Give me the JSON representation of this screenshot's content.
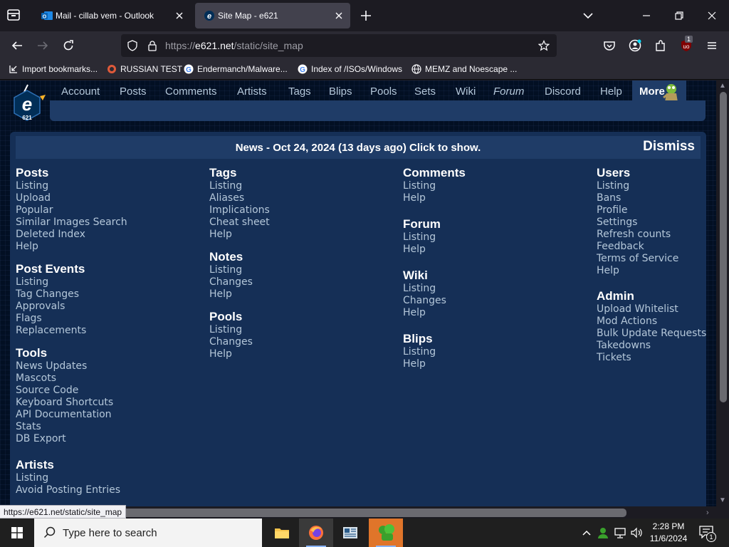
{
  "browser": {
    "tabs": [
      {
        "title": "Mail - cillab vem - Outlook",
        "active": false
      },
      {
        "title": "Site Map - e621",
        "active": true
      }
    ],
    "url_prefix": "https://",
    "url_domain": "e621.net",
    "url_path": "/static/site_map",
    "bookmarks": [
      {
        "label": "Import bookmarks...",
        "icon": "import-icon"
      },
      {
        "label": "RUSSIAN TEST",
        "icon": "page-icon"
      },
      {
        "label": "Endermanch/Malware...",
        "icon": "google-icon"
      },
      {
        "label": "Index of /ISOs/Windows",
        "icon": "google-icon"
      },
      {
        "label": "MEMZ and Noescape ...",
        "icon": "globe-icon"
      }
    ],
    "extension_badge": "1",
    "status_url": "https://e621.net/static/site_map"
  },
  "site": {
    "nav": [
      "Account",
      "Posts",
      "Comments",
      "Artists",
      "Tags",
      "Blips",
      "Pools",
      "Sets",
      "Wiki",
      "Forum",
      "Discord",
      "Help"
    ],
    "nav_more": "More",
    "news": "News - Oct 24, 2024 (13 days ago) Click to show.",
    "dismiss": "Dismiss",
    "columns": [
      [
        {
          "title": "Posts",
          "links": [
            "Listing",
            "Upload",
            "Popular",
            "Similar Images Search",
            "Deleted Index",
            "Help"
          ]
        },
        {
          "title": "Post Events",
          "links": [
            "Listing",
            "Tag Changes",
            "Approvals",
            "Flags",
            "Replacements"
          ]
        },
        {
          "title": "Tools",
          "links": [
            "News Updates",
            "Mascots",
            "Source Code",
            "Keyboard Shortcuts",
            "API Documentation",
            "Stats",
            "DB Export"
          ]
        },
        {
          "title": "Artists",
          "links": [
            "Listing",
            "Avoid Posting Entries"
          ]
        }
      ],
      [
        {
          "title": "Tags",
          "links": [
            "Listing",
            "Aliases",
            "Implications",
            "Cheat sheet",
            "Help"
          ]
        },
        {
          "title": "Notes",
          "links": [
            "Listing",
            "Changes",
            "Help"
          ]
        },
        {
          "title": "Pools",
          "links": [
            "Listing",
            "Changes",
            "Help"
          ]
        }
      ],
      [
        {
          "title": "Comments",
          "links": [
            "Listing",
            "Help"
          ]
        },
        {
          "title": "Forum",
          "links": [
            "Listing",
            "Help"
          ]
        },
        {
          "title": "Wiki",
          "links": [
            "Listing",
            "Changes",
            "Help"
          ]
        },
        {
          "title": "Blips",
          "links": [
            "Listing",
            "Help"
          ]
        }
      ],
      [
        {
          "title": "Users",
          "links": [
            "Listing",
            "Bans",
            "Profile",
            "Settings",
            "Refresh counts",
            "Feedback",
            "Terms of Service",
            "Help"
          ]
        },
        {
          "title": "Admin",
          "links": [
            "Upload Whitelist",
            "Mod Actions",
            "Bulk Update Requests",
            "Takedowns",
            "Tickets"
          ]
        }
      ]
    ]
  },
  "taskbar": {
    "search_placeholder": "Type here to search",
    "time": "2:28 PM",
    "date": "11/6/2024",
    "notification_count": "1"
  },
  "colors": {
    "page_bg": "#020f23",
    "content_bg": "#152f56",
    "bar_bg": "#1f3c67",
    "link": "#b4c7d9"
  }
}
